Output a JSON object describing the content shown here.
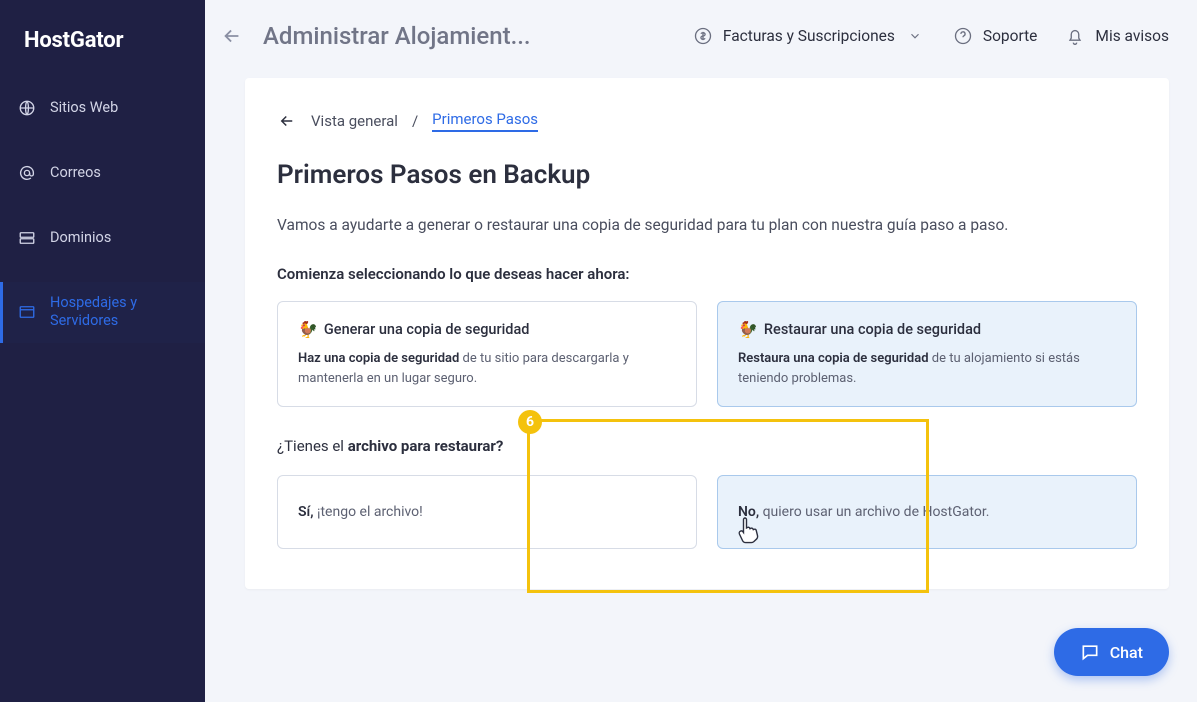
{
  "brand": "HostGator",
  "sidebar": {
    "items": [
      {
        "label": "Sitios Web",
        "icon": "globe-icon"
      },
      {
        "label": "Correos",
        "icon": "at-icon"
      },
      {
        "label": "Dominios",
        "icon": "server-icon"
      },
      {
        "label": "Hospedajes y Servidores",
        "icon": "window-icon"
      }
    ]
  },
  "topbar": {
    "title": "Administrar Alojamient...",
    "billing": "Facturas y Suscripciones",
    "support": "Soporte",
    "notices": "Mis avisos"
  },
  "crumbs": {
    "root": "Vista general",
    "sep": "/",
    "current": "Primeros Pasos"
  },
  "page": {
    "title": "Primeros Pasos en Backup",
    "desc": "Vamos a ayudarte a generar o restaurar una copia de seguridad para tu plan con nuestra guía paso a paso.",
    "select_lead": "Comienza seleccionando lo que deseas hacer ahora:"
  },
  "options": {
    "generate": {
      "emoji": "🐓",
      "title": "Generar una copia de seguridad",
      "desc_strong": "Haz una copia de seguridad",
      "desc_rest": " de tu sitio para descargarla y mantenerla en un lugar seguro."
    },
    "restore": {
      "emoji": "🐓",
      "title": "Restaurar una copia de seguridad",
      "desc_strong": "Restaura una copia de seguridad",
      "desc_rest": " de tu alojamiento si estás teniendo problemas."
    }
  },
  "question": {
    "prefix": "¿Tienes el ",
    "bold": "archivo para restaurar?",
    "yes_strong": "Sí,",
    "yes_rest": " ¡tengo el archivo!",
    "no_strong": "No,",
    "no_rest": " quiero usar un archivo de HostGator."
  },
  "highlight": {
    "number": "6"
  },
  "chat": {
    "label": "Chat"
  }
}
